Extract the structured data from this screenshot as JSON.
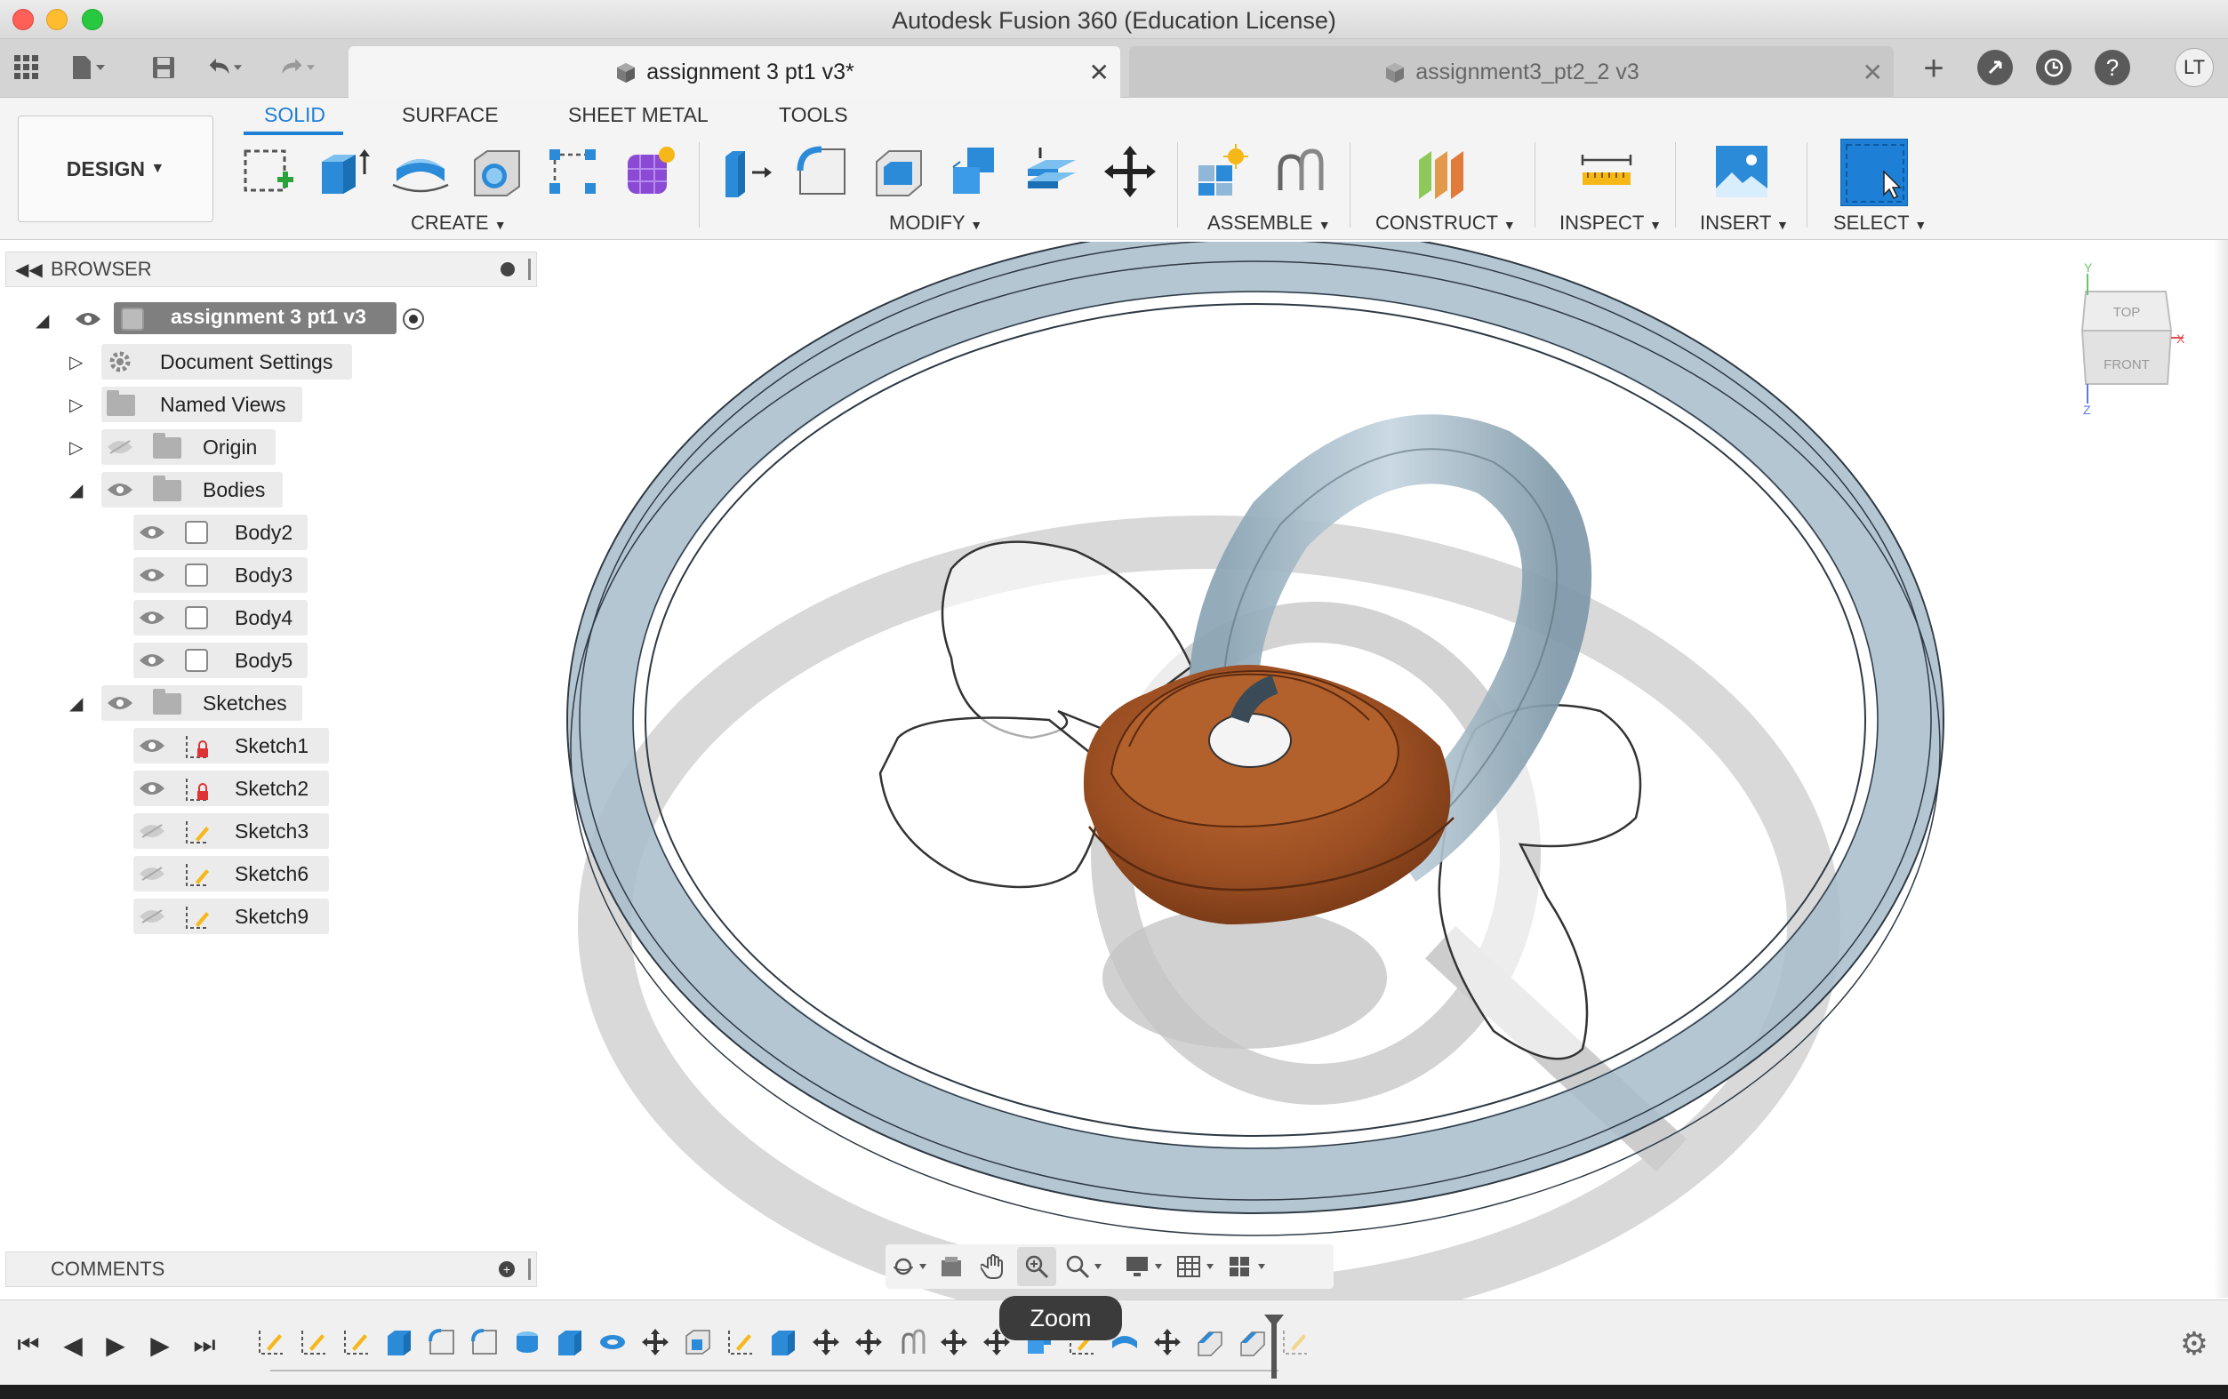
{
  "window": {
    "title": "Autodesk Fusion 360 (Education License)"
  },
  "tabs": [
    {
      "label": "assignment 3 pt1 v3*",
      "active": true
    },
    {
      "label": "assignment3_pt2_2 v3",
      "active": false
    }
  ],
  "user": {
    "initials": "LT"
  },
  "ribbon": {
    "workspace": "DESIGN",
    "tabs": [
      "SOLID",
      "SURFACE",
      "SHEET METAL",
      "TOOLS"
    ],
    "active_tab": "SOLID",
    "groups": [
      "CREATE",
      "MODIFY",
      "ASSEMBLE",
      "CONSTRUCT",
      "INSPECT",
      "INSERT",
      "SELECT"
    ]
  },
  "browser": {
    "title": "BROWSER",
    "root": "assignment 3 pt1 v3",
    "items": [
      {
        "label": "Document Settings"
      },
      {
        "label": "Named Views"
      },
      {
        "label": "Origin"
      },
      {
        "label": "Bodies"
      },
      {
        "label": "Body2"
      },
      {
        "label": "Body3"
      },
      {
        "label": "Body4"
      },
      {
        "label": "Body5"
      },
      {
        "label": "Sketches"
      },
      {
        "label": "Sketch1"
      },
      {
        "label": "Sketch2"
      },
      {
        "label": "Sketch3"
      },
      {
        "label": "Sketch6"
      },
      {
        "label": "Sketch9"
      }
    ]
  },
  "comments": {
    "title": "COMMENTS"
  },
  "viewcube": {
    "top": "TOP",
    "front": "FRONT",
    "axis_x": "X",
    "axis_y": "Y",
    "axis_z": "Z"
  },
  "tooltip": {
    "label": "Zoom"
  },
  "colors": {
    "accent": "#1e7fd6",
    "wood": "#9a4e22",
    "glass": "#9fb6c4"
  }
}
